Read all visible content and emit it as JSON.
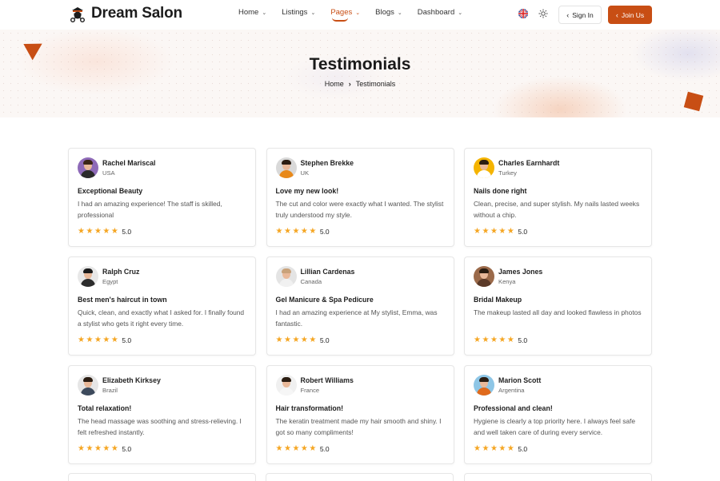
{
  "header": {
    "logo_text": "Dream Salon",
    "nav": [
      {
        "label": "Home",
        "active": false
      },
      {
        "label": "Listings",
        "active": false
      },
      {
        "label": "Pages",
        "active": true
      },
      {
        "label": "Blogs",
        "active": false
      },
      {
        "label": "Dashboard",
        "active": false
      }
    ],
    "signin_label": "Sign In",
    "join_label": "Join Us",
    "accent": "#c84e14"
  },
  "hero": {
    "title": "Testimonials",
    "breadcrumb": [
      "Home",
      "Testimonials"
    ]
  },
  "testimonials": [
    {
      "name": "Rachel Mariscal",
      "country": "USA",
      "title": "Exceptional Beauty",
      "text": "I had an amazing experience! The staff is skilled, professional",
      "rating": "5.0",
      "avatar_bg": "#8e6ab8",
      "shirt": "#2a2a2a",
      "hair": "#3b2616"
    },
    {
      "name": "Stephen Brekke",
      "country": "UK",
      "title": "Love my new look!",
      "text": "The cut and color were exactly what I wanted. The stylist truly understood my style.",
      "rating": "5.0",
      "avatar_bg": "#d9d9d9",
      "shirt": "#e8891a",
      "hair": "#2b1d12"
    },
    {
      "name": "Charles Earnhardt",
      "country": "Turkey",
      "title": "Nails done right",
      "text": "Clean, precise, and super stylish. My nails lasted weeks without a chip.",
      "rating": "5.0",
      "avatar_bg": "#f5b400",
      "shirt": "#ffffff",
      "hair": "#2b1d12"
    },
    {
      "name": "Ralph Cruz",
      "country": "Egypt",
      "title": "Best men's haircut in town",
      "text": "Quick, clean, and exactly what I asked for. I finally found a stylist who gets it right every time.",
      "rating": "5.0",
      "avatar_bg": "#e8e8e8",
      "shirt": "#2c2c2c",
      "hair": "#1a1a1a"
    },
    {
      "name": "Lillian Cardenas",
      "country": "Canada",
      "title": "Gel Manicure & Spa Pedicure",
      "text": "I had an amazing experience at  My stylist, Emma, was fantastic.",
      "rating": "5.0",
      "avatar_bg": "#e4e4e4",
      "shirt": "#f1f1f1",
      "hair": "#c9a27a"
    },
    {
      "name": "James Jones",
      "country": "Kenya",
      "title": "Bridal Makeup",
      "text": "The makeup lasted all day and looked flawless in photos",
      "rating": "5.0",
      "avatar_bg": "#9b6a4a",
      "shirt": "#5b3a28",
      "hair": "#2b1d12"
    },
    {
      "name": "Elizabeth Kirksey",
      "country": "Brazil",
      "title": "Total relaxation!",
      "text": "The head massage was soothing and stress-relieving. I felt refreshed instantly.",
      "rating": "5.0",
      "avatar_bg": "#e6e6e6",
      "shirt": "#3d4a5c",
      "hair": "#2b1d12"
    },
    {
      "name": "Robert Williams",
      "country": "France",
      "title": "Hair transformation!",
      "text": "The keratin treatment made my hair smooth and shiny. I got so many compliments!",
      "rating": "5.0",
      "avatar_bg": "#f0f0f0",
      "shirt": "#f6f6f6",
      "hair": "#2b1d12"
    },
    {
      "name": "Marion Scott",
      "country": "Argentina",
      "title": "Professional and clean!",
      "text": "Hygiene is clearly a top priority here. I always feel safe and well taken care of during every service.",
      "rating": "5.0",
      "avatar_bg": "#8ec6e6",
      "shirt": "#e06a1c",
      "hair": "#2b1d12"
    }
  ]
}
